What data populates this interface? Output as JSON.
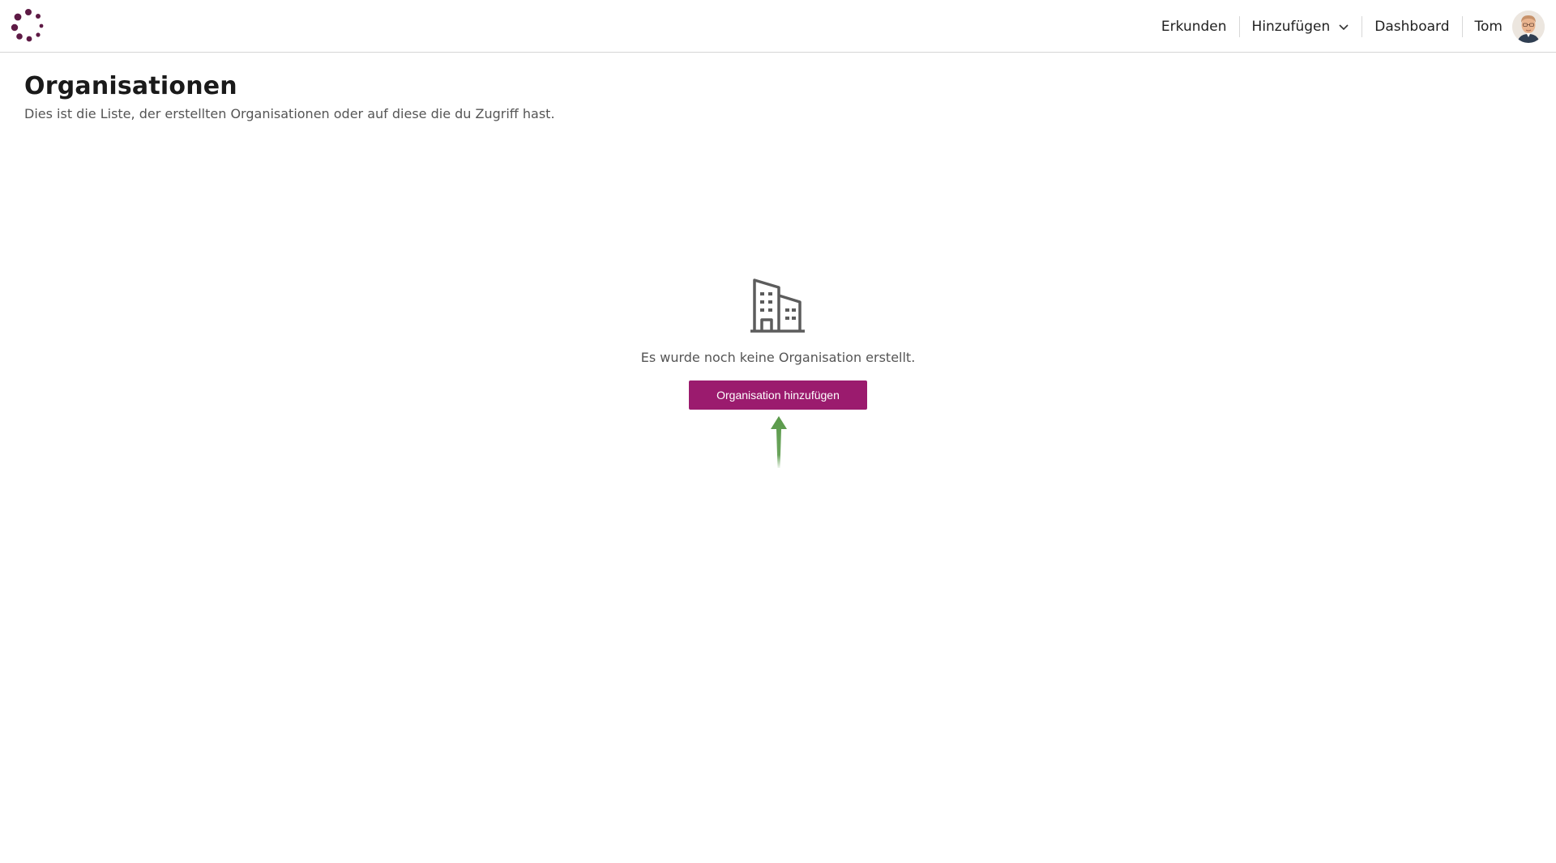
{
  "nav": {
    "items": [
      {
        "label": "Erkunden"
      },
      {
        "label": "Hinzufügen"
      },
      {
        "label": "Dashboard"
      }
    ],
    "user_name": "Tom"
  },
  "page": {
    "title": "Organisationen",
    "subtitle": "Dies ist die Liste, der erstellten Organisationen oder auf diese die du Zugriff hast."
  },
  "empty_state": {
    "icon": "building-icon",
    "message": "Es wurde noch keine Organisation erstellt.",
    "button_label": "Organisation hinzufügen"
  },
  "colors": {
    "accent": "#9b1b6e",
    "logo": "#5e1a45",
    "arrow": "#5a9a4a"
  }
}
